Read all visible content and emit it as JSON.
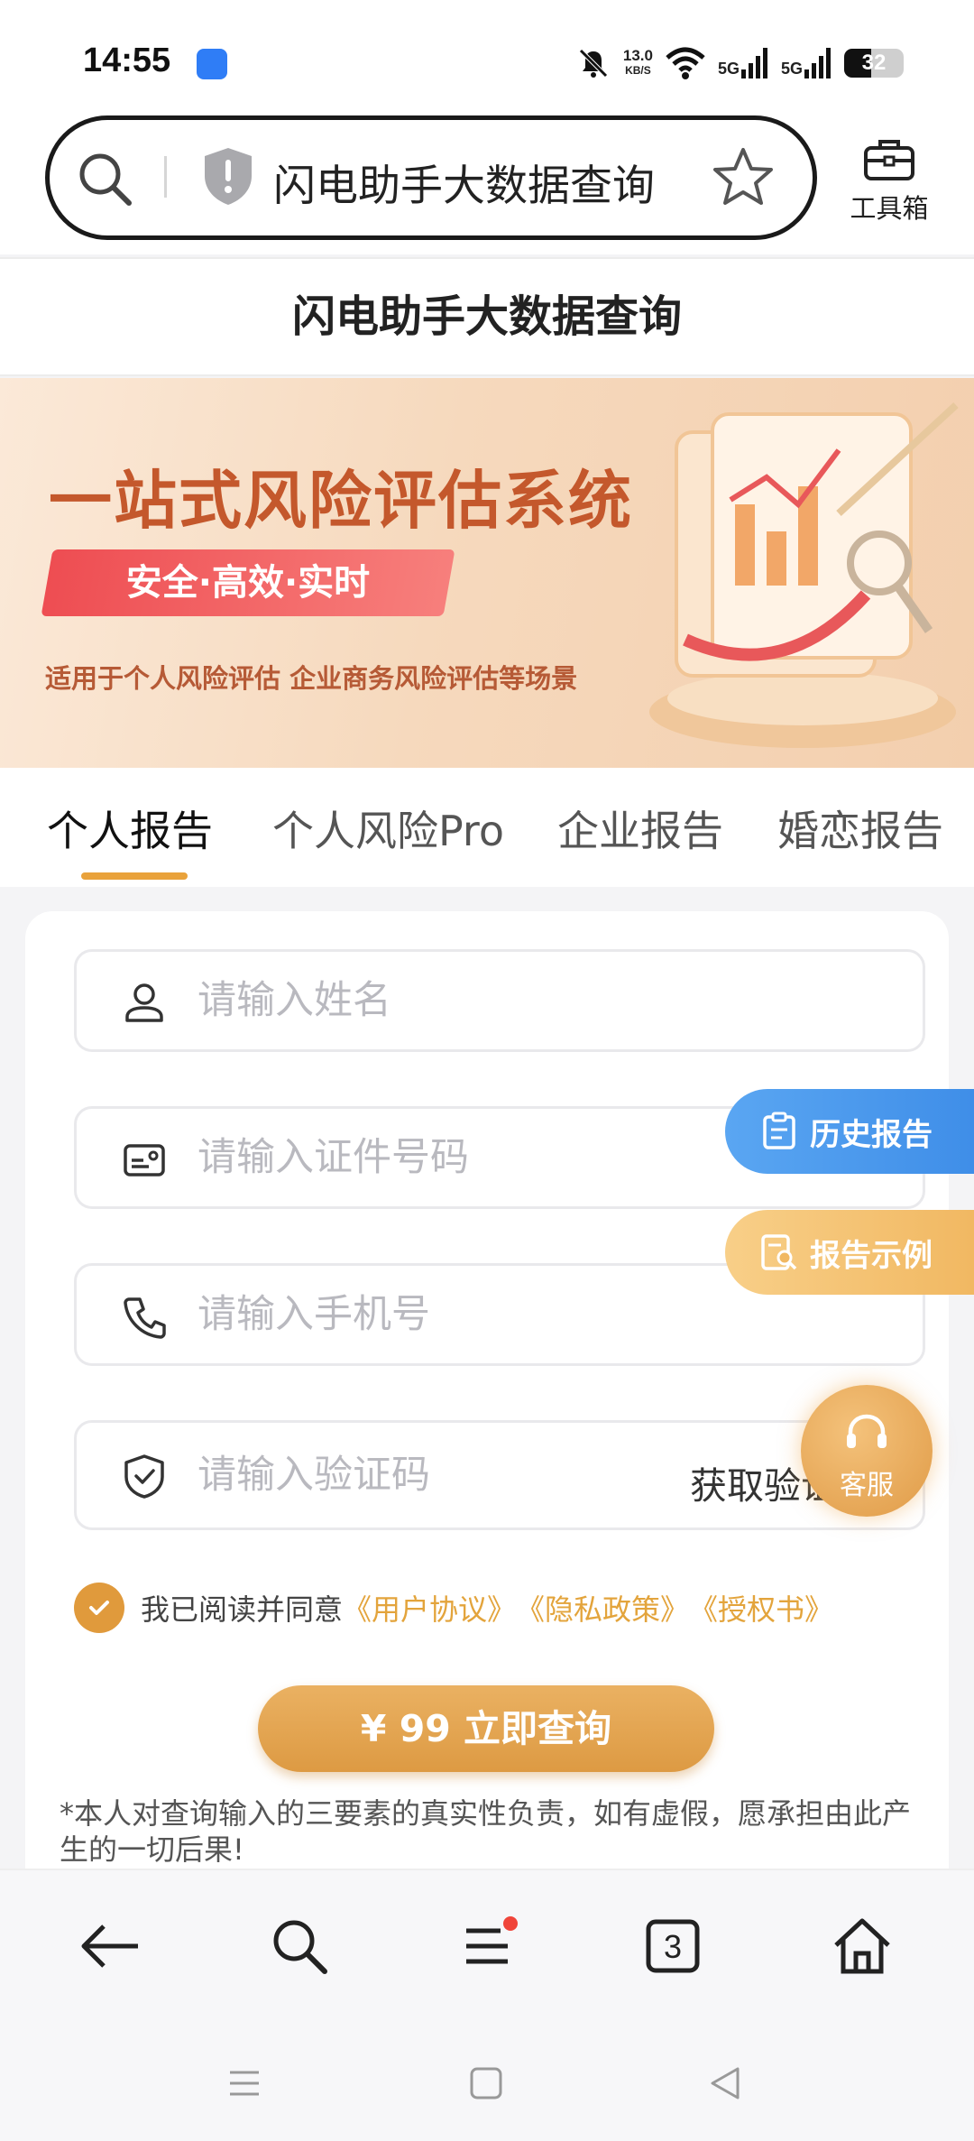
{
  "status_bar": {
    "time": "14:55",
    "speed_value": "13.0",
    "speed_unit": "KB/S",
    "net1": "5G",
    "net2": "5G",
    "battery": "32"
  },
  "browser": {
    "address_text": "闪电助手大数据查询",
    "toolbox_label": "工具箱"
  },
  "page": {
    "title": "闪电助手大数据查询"
  },
  "banner": {
    "title": "一站式风险评估系统",
    "tag": "安全·高效·实时",
    "subtitle": "适用于个人风险评估 企业商务风险评估等场景"
  },
  "tabs": [
    {
      "label": "个人报告",
      "active": true
    },
    {
      "label": "个人风险Pro",
      "active": false
    },
    {
      "label": "企业报告",
      "active": false
    },
    {
      "label": "婚恋报告",
      "active": false
    }
  ],
  "form": {
    "name_placeholder": "请输入姓名",
    "id_placeholder": "请输入证件号码",
    "phone_placeholder": "请输入手机号",
    "code_placeholder": "请输入验证码",
    "get_code_label": "获取验证码",
    "agree_text": "我已阅读并同意",
    "agree_links": [
      "《用户协议》",
      "《隐私政策》",
      "《授权书》"
    ],
    "submit_label": "¥ 99 立即查询",
    "disclaimer": "*本人对查询输入的三要素的真实性负责，如有虚假，愿承担由此产生的一切后果!"
  },
  "floating": {
    "history_label": "历史报告",
    "sample_label": "报告示例",
    "service_label": "客服"
  },
  "bottom_bar": {
    "tab_count": "3"
  },
  "colors": {
    "accent": "#e09a3c",
    "link": "#e3a43c",
    "history_blue": "#4a97ec",
    "banner_title": "#c4582c"
  }
}
